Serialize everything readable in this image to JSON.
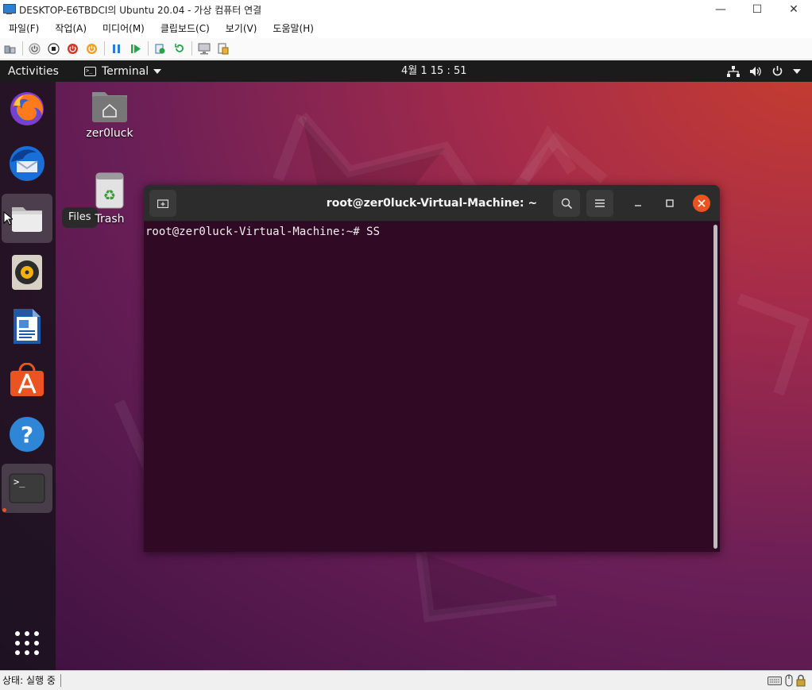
{
  "host": {
    "window_title": "DESKTOP-E6TBDCI의 Ubuntu 20.04 - 가상 컴퓨터 연결",
    "menu": [
      "파일(F)",
      "작업(A)",
      "미디어(M)",
      "클립보드(C)",
      "보기(V)",
      "도움말(H)"
    ],
    "status_text": "상태: 실행 중"
  },
  "guest": {
    "topbar": {
      "activities": "Activities",
      "app_name": "Terminal",
      "clock": "4월 1  15 : 51"
    },
    "dock_items": [
      {
        "name": "Firefox",
        "icon": "firefox-icon"
      },
      {
        "name": "Thunderbird",
        "icon": "thunderbird-icon"
      },
      {
        "name": "Files",
        "icon": "files-icon"
      },
      {
        "name": "Rhythmbox",
        "icon": "rhythmbox-icon"
      },
      {
        "name": "LibreOffice Writer",
        "icon": "writer-icon"
      },
      {
        "name": "Ubuntu Software",
        "icon": "software-icon"
      },
      {
        "name": "Help",
        "icon": "help-icon"
      },
      {
        "name": "Terminal",
        "icon": "terminal-icon"
      }
    ],
    "tooltip": "Files",
    "desktop_icons": [
      {
        "label": "zer0luck",
        "icon": "home-folder-icon"
      },
      {
        "label": "Trash",
        "icon": "trash-icon"
      }
    ],
    "terminal": {
      "title": "root@zer0luck-Virtual-Machine: ~",
      "prompt_line": "root@zer0luck-Virtual-Machine:~# SS"
    }
  },
  "colors": {
    "ubuntu_orange": "#e95420",
    "terminal_bg": "#300a24",
    "topbar_bg": "#1b1b1b"
  }
}
